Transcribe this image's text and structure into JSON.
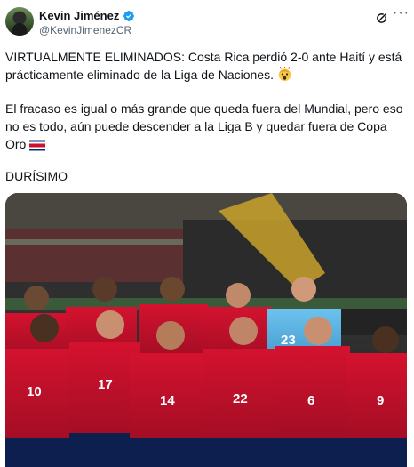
{
  "author": {
    "name": "Kevin Jiménez",
    "handle": "@KevinJimenezCR",
    "verified": true,
    "avatar_icon": "profile-avatar"
  },
  "actions": {
    "grok_icon": "grok-icon",
    "more_icon": "more-icon"
  },
  "post": {
    "paragraph1": "VIRTUALMENTE ELIMINADOS: Costa Rica perdió 2-0 ante Haití y está prácticamente eliminado de la Liga de Naciones.",
    "paragraph2": "El fracaso es igual o más grande que queda fuera del Mundial, pero eso no es todo, aún puede descender a la Liga B y quedar fuera de Copa Oro",
    "paragraph3": "DURÍSIMO",
    "emoji1": "shocked-face-emoji",
    "emoji2": "costa-rica-flag-emoji"
  },
  "media": {
    "description_icon": "team-photo",
    "jersey_numbers": [
      "10",
      "17",
      "14",
      "22",
      "6",
      "9",
      "23"
    ],
    "colors": {
      "jersey": "#c8102e",
      "goalkeeper": "#5ab4e5",
      "shorts": "#0d1f4f"
    }
  }
}
